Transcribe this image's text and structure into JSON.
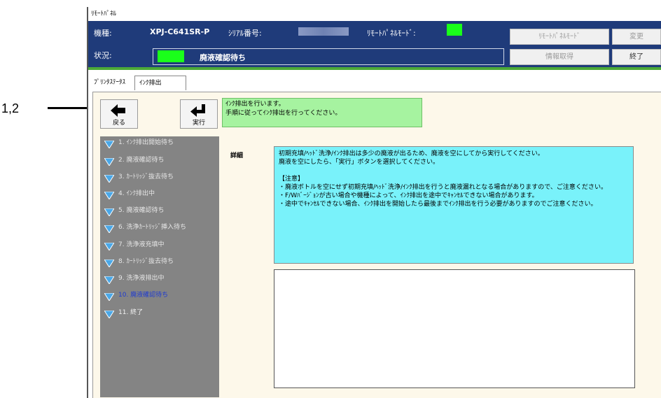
{
  "callout": {
    "label": "1,2"
  },
  "window": {
    "title": "ﾘﾓｰﾄﾊﾟﾈﾙ",
    "model_label": "機種:",
    "model_value": "XPJ-C641SR-P",
    "serial_label": "ｼﾘｱﾙ番号:",
    "remote_label": "ﾘﾓｰﾄﾊﾟﾈﾙﾓｰﾄﾞ:",
    "status_label": "状況:",
    "status_value": "廃液確認待ち",
    "remote_mode_button": "ﾘﾓｰﾄﾊﾟﾈﾙﾓｰﾄﾞ",
    "change_button": "変更",
    "info_button": "情報取得",
    "end_button": "終了",
    "accent_color": "#4caa38",
    "topbar_color": "#1f3b7a"
  },
  "tabs": [
    {
      "label": "ﾌﾟﾘﾝﾀｽﾃｰﾀｽ"
    },
    {
      "label": "ｲﾝｸ排出"
    }
  ],
  "buttons": {
    "back": "戻る",
    "execute": "実行"
  },
  "message": {
    "line1": "ｲﾝｸ排出を行います。",
    "line2": "手順に従ってｲﾝｸ排出を行ってください。"
  },
  "steps": [
    {
      "label": "1. ｲﾝｸ排出開始待ち"
    },
    {
      "label": "2. 廃液確認待ち"
    },
    {
      "label": "3. ｶｰﾄﾘｯｼﾞ抜去待ち"
    },
    {
      "label": "4. ｲﾝｸ排出中"
    },
    {
      "label": "5. 廃液確認待ち"
    },
    {
      "label": "6. 洗浄ｶｰﾄﾘｯｼﾞ挿入待ち"
    },
    {
      "label": "7. 洗浄液充填中"
    },
    {
      "label": "8. ｶｰﾄﾘｯｼﾞ抜去待ち"
    },
    {
      "label": "9. 洗浄液排出中"
    },
    {
      "label": "10. 廃液確認待ち"
    },
    {
      "label": "11. 終了"
    }
  ],
  "active_step_index": 9,
  "detail": {
    "label": "詳細",
    "lines": [
      "初期充填/ﾍｯﾄﾞ洗浄/ｲﾝｸ排出は多少の廃液が出るため、廃液を空にしてから実行してください。",
      "廃液を空にしたら、「実行」ボタンを選択してください。",
      "",
      "【注意】",
      "・廃液ボトルを空にせず初期充填/ﾍｯﾄﾞ洗浄/ｲﾝｸ排出を行うと廃液漏れとなる場合がありますので、ご注意ください。",
      "・F/Wﾊﾞｰｼﾞｮﾝが古い場合や機種によって、ｲﾝｸ排出を途中でｷｬﾝｾﾙできない場合があります。",
      "・途中でｷｬﾝｾﾙできない場合、ｲﾝｸ排出を開始したら最後までｲﾝｸ排出を行う必要がありますのでご注意ください。"
    ]
  },
  "icons": {
    "back": "arrow-left-icon",
    "execute": "return-arrow-icon",
    "step": "triangle-down-icon"
  }
}
